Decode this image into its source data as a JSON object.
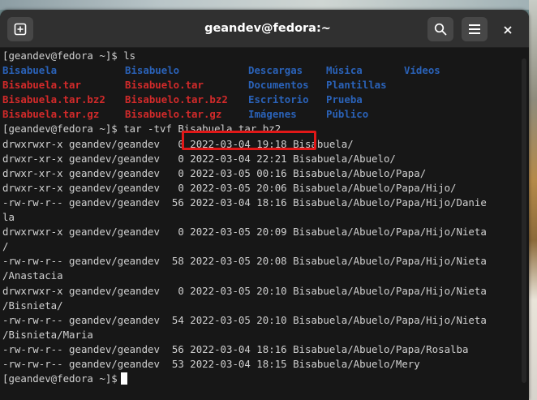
{
  "window": {
    "title": "geandev@fedora:~",
    "new_tab_icon": "plus-square-icon",
    "search_icon": "search-icon",
    "menu_icon": "hamburger-menu-icon",
    "close_icon": "close-icon"
  },
  "terminal": {
    "prompt1": "[geandev@fedora ~]$ ls",
    "ls_output": [
      {
        "name": "Bisabuela",
        "type": "dir"
      },
      {
        "name": "Bisabuelo",
        "type": "dir"
      },
      {
        "name": "Descargas",
        "type": "dir"
      },
      {
        "name": "Música",
        "type": "dir"
      },
      {
        "name": "Vídeos",
        "type": "dir"
      },
      {
        "name": "Bisabuela.tar",
        "type": "archive"
      },
      {
        "name": "Bisabuelo.tar",
        "type": "archive"
      },
      {
        "name": "Documentos",
        "type": "dir"
      },
      {
        "name": "Plantillas",
        "type": "dir"
      },
      {
        "name": "Bisabuela.tar.bz2",
        "type": "archive"
      },
      {
        "name": "Bisabuelo.tar.bz2",
        "type": "archive"
      },
      {
        "name": "Escritorio",
        "type": "dir"
      },
      {
        "name": "Prueba",
        "type": "dir"
      },
      {
        "name": "Bisabuela.tar.gz",
        "type": "archive"
      },
      {
        "name": "Bisabuelo.tar.gz",
        "type": "archive"
      },
      {
        "name": "Imágenes",
        "type": "dir"
      },
      {
        "name": "Público",
        "type": "dir"
      }
    ],
    "prompt2": "[geandev@fedora ~]$ tar -tvf Bisabuela.tar.bz2",
    "tar_output": [
      "drwxrwxr-x geandev/geandev   0 2022-03-04 19:18 Bisabuela/",
      "drwxr-xr-x geandev/geandev   0 2022-03-04 22:21 Bisabuela/Abuelo/",
      "drwxr-xr-x geandev/geandev   0 2022-03-05 00:16 Bisabuela/Abuelo/Papa/",
      "drwxr-xr-x geandev/geandev   0 2022-03-05 20:06 Bisabuela/Abuelo/Papa/Hijo/",
      "-rw-rw-r-- geandev/geandev  56 2022-03-04 18:16 Bisabuela/Abuelo/Papa/Hijo/Danie",
      "la",
      "drwxrwxr-x geandev/geandev   0 2022-03-05 20:09 Bisabuela/Abuelo/Papa/Hijo/Nieta",
      "/",
      "-rw-rw-r-- geandev/geandev  58 2022-03-05 20:08 Bisabuela/Abuelo/Papa/Hijo/Nieta",
      "/Anastacia",
      "drwxrwxr-x geandev/geandev   0 2022-03-05 20:10 Bisabuela/Abuelo/Papa/Hijo/Nieta",
      "/Bisnieta/",
      "-rw-rw-r-- geandev/geandev  54 2022-03-05 20:10 Bisabuela/Abuelo/Papa/Hijo/Nieta",
      "/Bisnieta/Maria",
      "-rw-rw-r-- geandev/geandev  56 2022-03-04 18:16 Bisabuela/Abuelo/Papa/Rosalba",
      "-rw-rw-r-- geandev/geandev  53 2022-03-04 18:15 Bisabuela/Abuelo/Mery"
    ],
    "prompt3": "[geandev@fedora ~]$"
  },
  "colors": {
    "directory": "#2a62b8",
    "archive": "#d22a2a",
    "highlight_box": "#e11818"
  }
}
